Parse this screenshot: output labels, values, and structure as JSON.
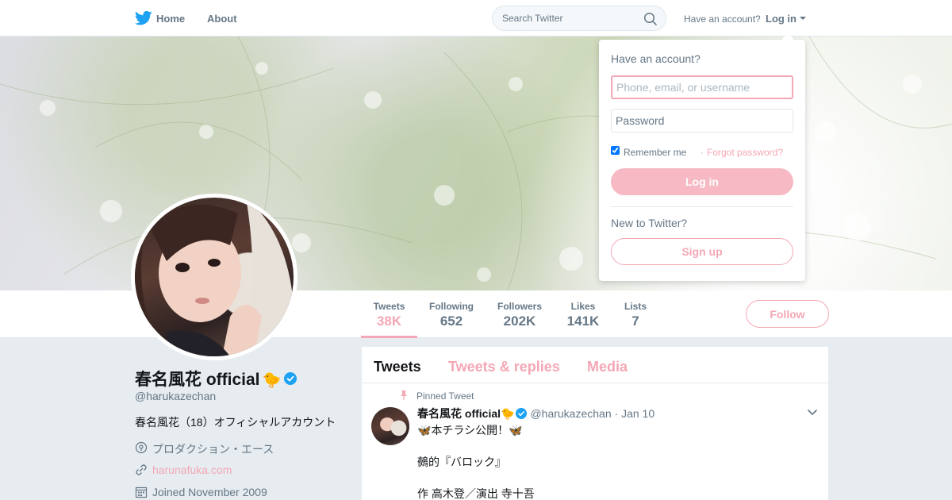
{
  "topbar": {
    "home_label": "Home",
    "about_label": "About",
    "search_placeholder": "Search Twitter",
    "have_account_label": "Have an account?",
    "login_label": "Log in"
  },
  "profile": {
    "name": "春名風花 official",
    "name_emoji": "🐤",
    "handle": "@harukazechan",
    "bio": "春名風花（18）オフィシャルアカウント",
    "location": "プロダクション・エース",
    "website": "harunafuka.com",
    "joined": "Joined November 2009"
  },
  "stats": [
    {
      "label": "Tweets",
      "value": "38K"
    },
    {
      "label": "Following",
      "value": "652"
    },
    {
      "label": "Followers",
      "value": "202K"
    },
    {
      "label": "Likes",
      "value": "141K"
    },
    {
      "label": "Lists",
      "value": "7"
    }
  ],
  "follow_label": "Follow",
  "timeline": {
    "tabs": [
      "Tweets",
      "Tweets & replies",
      "Media"
    ],
    "pinned": {
      "label": "Pinned Tweet",
      "name": "春名風花 official",
      "name_emoji": "🐤",
      "handle": "@harukazechan",
      "separator": "·",
      "date": "Jan 10",
      "line1_emoji": "🦋",
      "line1_text": "本チラシ公開！",
      "line2": "鵺的『バロック』",
      "line3": "作 高木登／演出 寺十吾"
    }
  },
  "login_dropdown": {
    "title": "Have an account?",
    "username_placeholder": "Phone, email, or username",
    "password_placeholder": "Password",
    "remember_label": "Remember me",
    "separator": "·",
    "forgot_label": "Forgot password?",
    "login_button": "Log in",
    "new_label": "New to Twitter?",
    "signup_button": "Sign up"
  },
  "colors": {
    "accent": "#f4a7b4",
    "twitter_blue": "#1da1f2",
    "muted_text": "#657786",
    "page_bg": "#e6ecf0"
  }
}
